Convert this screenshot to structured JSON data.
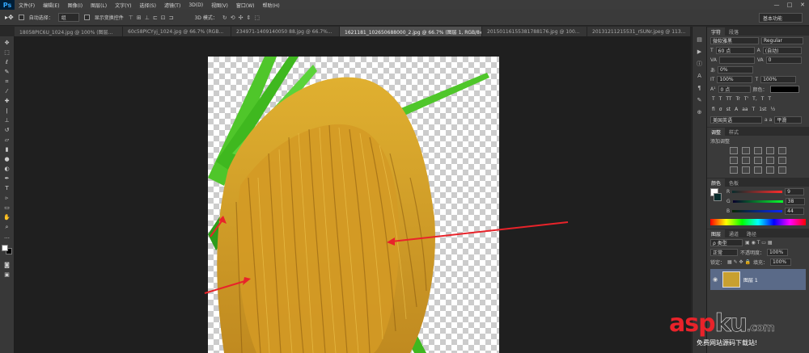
{
  "app": {
    "logo": "Ps"
  },
  "menu": [
    "文件(F)",
    "编辑(E)",
    "图像(I)",
    "图层(L)",
    "文字(Y)",
    "选择(S)",
    "滤镜(T)",
    "3D(D)",
    "视图(V)",
    "窗口(W)",
    "帮助(H)"
  ],
  "window_controls": [
    "—",
    "□",
    "✕"
  ],
  "options_bar": {
    "auto_select_label": "自动选择：",
    "auto_select_value": "组",
    "show_transform_label": "显示变换控件",
    "mode_3d_label": "3D 模式：",
    "workspace": "基本功能"
  },
  "tabs": [
    {
      "label": "18058PIC6U_1024.jpg @ 100% (图层...",
      "active": false
    },
    {
      "label": "60c58PICYyj_1024.jpg @ 66.7% (RGB...",
      "active": false
    },
    {
      "label": "234971-1409140050 88.jpg @ 66.7%...",
      "active": false
    },
    {
      "label": "1621181_102650688000_2.jpg @ 66.7% (图层 1, RGB/8#) *",
      "active": true
    },
    {
      "label": "20150116155381788176.jpg @ 100...",
      "active": false
    },
    {
      "label": "20131211215531_rSUNr.jpeg @ 113...",
      "active": false
    }
  ],
  "toolbar_icons": [
    "move-tool-icon",
    "marquee-tool-icon",
    "lasso-tool-icon",
    "quick-select-tool-icon",
    "crop-tool-icon",
    "eyedropper-tool-icon",
    "healing-brush-icon",
    "brush-tool-icon",
    "clone-stamp-icon",
    "history-brush-icon",
    "eraser-tool-icon",
    "gradient-tool-icon",
    "blur-tool-icon",
    "dodge-tool-icon",
    "pen-tool-icon",
    "type-tool-icon",
    "path-select-icon",
    "shape-tool-icon",
    "hand-tool-icon",
    "zoom-tool-icon"
  ],
  "character_panel": {
    "tabs": [
      "字符",
      "段落"
    ],
    "font_family": "微软雅黑",
    "font_style": "Regular",
    "font_size": "60 点",
    "leading": "(自动)",
    "kerning": "",
    "tracking": "0",
    "scale_pct": "0%",
    "vertical_scale": "100%",
    "horizontal_scale": "100%",
    "baseline": "0 点",
    "color_label": "颜色：",
    "glyph_buttons": [
      "T",
      "T",
      "TT",
      "Tr",
      "T'",
      "T,",
      "T",
      "T"
    ],
    "glyph_buttons2": [
      "fi",
      "σ",
      "st",
      "A",
      "aa",
      "T",
      "1st",
      "½"
    ],
    "language": "美国英语",
    "aa_label": "a a",
    "aa_value": "平滑"
  },
  "adjustments_panel": {
    "tabs": [
      "调整",
      "样式"
    ],
    "title": "添加调整"
  },
  "color_panel": {
    "tabs": [
      "颜色",
      "色板"
    ],
    "r": "9",
    "g": "38",
    "b": "44",
    "r_label": "R",
    "g_label": "G",
    "b_label": "B"
  },
  "layers_panel": {
    "tabs": [
      "图层",
      "通道",
      "路径"
    ],
    "filter": "ρ 类型",
    "blend_mode": "正常",
    "opacity_label": "不透明度：",
    "opacity": "100%",
    "lock_label": "锁定：",
    "fill_label": "填充：",
    "fill": "100%",
    "layer_name": "图层 1"
  },
  "watermark": {
    "brand_a": "asp",
    "brand_b": "ku",
    "brand_c": ".com",
    "tagline": "免费网站源码下载站!"
  },
  "colors": {
    "accent_red": "#e8232a",
    "layer_selected": "#5a6a88",
    "canvas_bg": "#1f1f1f"
  }
}
